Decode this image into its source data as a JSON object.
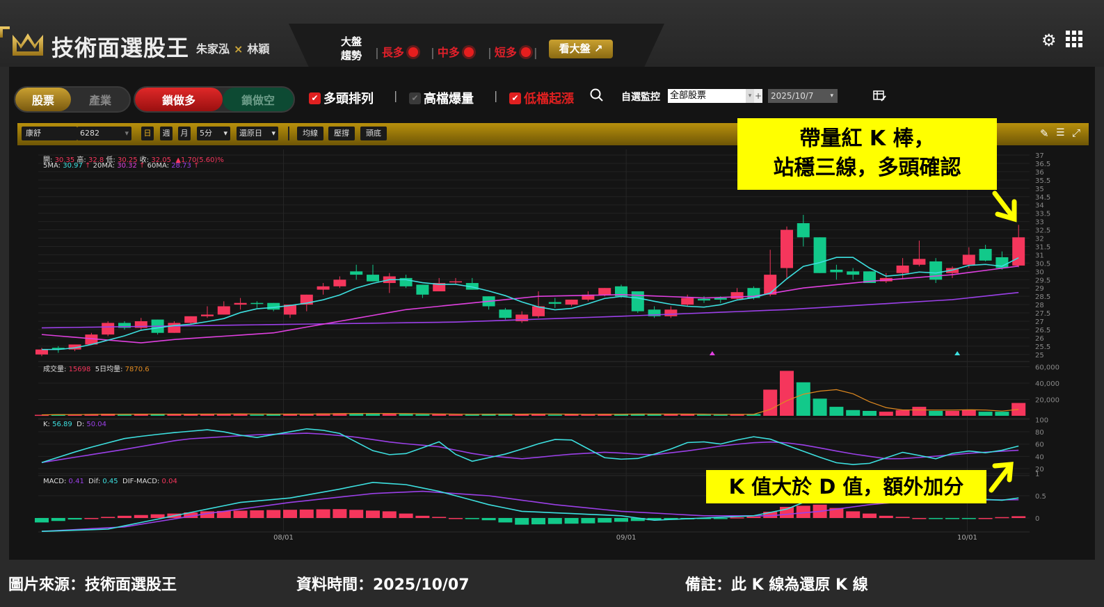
{
  "header": {
    "title": "技術面選股王",
    "author1": "朱家泓",
    "times": "×",
    "author2": "林穎",
    "trend_line1": "大盤",
    "trend_line2": "趨勢",
    "trends": [
      "長多",
      "中多",
      "短多"
    ],
    "view_market": "看大盤"
  },
  "filters": {
    "seg1": [
      "股票",
      "產業"
    ],
    "seg2": [
      "鎖做多",
      "鎖做空"
    ],
    "checks": [
      {
        "label": "多頭排列",
        "checked": true
      },
      {
        "label": "高檔爆量",
        "checked": false
      },
      {
        "label": "低檔起漲",
        "checked": true
      }
    ],
    "watch_label": "自選監控",
    "watch_value": "全部股票",
    "plus": "+",
    "date_value": "2025/10/7"
  },
  "chart_toolbar": {
    "stock_name": "康舒",
    "stock_code": "6282",
    "periods": [
      "日",
      "週",
      "月"
    ],
    "interval": "5分",
    "adjust": "還原日",
    "buttons": [
      "均線",
      "壓撐",
      "頭底"
    ]
  },
  "info": {
    "open_l": "開:",
    "open": "30.35",
    "high_l": "高:",
    "high": "32.8",
    "low_l": "低:",
    "low": "30.25",
    "close_l": "收:",
    "close": "32.05",
    "change": "▲1.70(5.60)%",
    "ma5_l": "5MA:",
    "ma5": "30.97",
    "ma20_l": "20MA:",
    "ma20": "30.32",
    "ma60_l": "60MA:",
    "ma60": "28.73",
    "arrow": "↑",
    "vol_l": "成交量:",
    "vol": "15698",
    "vol5_l": "5日均量:",
    "vol5": "7870.6",
    "k_l": "K:",
    "k": "56.89",
    "d_l": "D:",
    "d": "50.04",
    "macd_l": "MACD:",
    "macd": "0.41",
    "dif_l": "Dif:",
    "dif": "0.45",
    "osc_l": "DIF-MACD:",
    "osc": "0.04"
  },
  "annotations": {
    "box1_line1": "帶量紅 K 棒，",
    "box1_line2": "站穩三線，多頭確認",
    "box2": "K 值大於 D 值，額外加分"
  },
  "footer": {
    "source": "圖片來源：技術面選股王",
    "time": "資料時間：2025/10/07",
    "note": "備註：此 K 線為還原 K 線"
  },
  "colors": {
    "up": "#f5365c",
    "down": "#12c98a",
    "ma5": "#3de0e0",
    "ma20": "#e040e0",
    "ma60": "#9b40e8",
    "vol5": "#e08a20",
    "gold": "#c9a030"
  },
  "chart_data": {
    "type": "candlestick",
    "price_ticks": [
      "37",
      "36.5",
      "36",
      "35.5",
      "35",
      "34.5",
      "34",
      "33.5",
      "33",
      "32.5",
      "32",
      "31.5",
      "31",
      "30.5",
      "30",
      "29.5",
      "29",
      "28.5",
      "28",
      "27.5",
      "27",
      "26.5",
      "26",
      "25.5",
      "25"
    ],
    "volume_ticks": [
      "60,000",
      "40,000",
      "20,000"
    ],
    "kd_ticks": [
      "100",
      "80",
      "60",
      "40",
      "20"
    ],
    "macd_ticks": [
      "1",
      "0.5",
      "0"
    ],
    "date_ticks": [
      {
        "i": 14.6,
        "label": "08/01"
      },
      {
        "i": 35.3,
        "label": "09/01"
      },
      {
        "i": 55.9,
        "label": "10/01"
      }
    ],
    "ohlc": [
      [
        25.0,
        25.4,
        24.9,
        25.3
      ],
      [
        25.4,
        25.5,
        25.1,
        25.3
      ],
      [
        25.3,
        25.6,
        25.2,
        25.6
      ],
      [
        25.6,
        26.3,
        25.6,
        26.2
      ],
      [
        26.2,
        27.0,
        26.1,
        26.9
      ],
      [
        26.9,
        27.0,
        26.5,
        26.6
      ],
      [
        26.6,
        27.2,
        26.5,
        27.0
      ],
      [
        27.1,
        27.1,
        26.2,
        26.3
      ],
      [
        26.3,
        27.0,
        26.3,
        26.9
      ],
      [
        26.9,
        27.3,
        26.8,
        27.3
      ],
      [
        27.3,
        27.9,
        27.2,
        27.4
      ],
      [
        27.4,
        28.2,
        27.4,
        27.9
      ],
      [
        28.0,
        28.4,
        27.7,
        28.1
      ],
      [
        28.1,
        28.2,
        27.8,
        28.05
      ],
      [
        28.1,
        28.1,
        27.6,
        27.7
      ],
      [
        27.4,
        28.0,
        27.2,
        28.0
      ],
      [
        28.0,
        28.6,
        27.6,
        28.6
      ],
      [
        28.9,
        29.3,
        28.6,
        29.1
      ],
      [
        29.1,
        29.7,
        29.0,
        29.5
      ],
      [
        30.0,
        30.4,
        29.5,
        29.8
      ],
      [
        29.8,
        30.4,
        29.4,
        29.4
      ],
      [
        29.3,
        29.9,
        28.7,
        29.7
      ],
      [
        29.6,
        29.8,
        29.0,
        29.1
      ],
      [
        29.2,
        29.2,
        28.4,
        28.6
      ],
      [
        28.8,
        29.6,
        28.8,
        29.3
      ],
      [
        29.35,
        29.6,
        29.2,
        29.4
      ],
      [
        29.3,
        29.6,
        28.9,
        28.9
      ],
      [
        28.5,
        28.5,
        27.7,
        27.9
      ],
      [
        27.7,
        27.8,
        27.1,
        27.2
      ],
      [
        27.0,
        27.6,
        26.9,
        27.4
      ],
      [
        27.3,
        28.8,
        27.2,
        27.9
      ],
      [
        28.15,
        28.4,
        27.8,
        28.05
      ],
      [
        28.0,
        28.3,
        27.9,
        28.3
      ],
      [
        28.3,
        28.8,
        28.2,
        28.6
      ],
      [
        28.6,
        29.0,
        28.5,
        29.0
      ],
      [
        29.1,
        29.2,
        28.4,
        28.5
      ],
      [
        28.8,
        28.8,
        27.5,
        27.6
      ],
      [
        27.7,
        27.9,
        27.2,
        27.3
      ],
      [
        27.3,
        27.9,
        27.2,
        27.7
      ],
      [
        28.0,
        28.6,
        27.9,
        28.4
      ],
      [
        28.35,
        28.5,
        28.1,
        28.25
      ],
      [
        28.4,
        28.5,
        28.1,
        28.3
      ],
      [
        28.35,
        29.0,
        28.3,
        28.75
      ],
      [
        29.0,
        29.1,
        28.3,
        28.4
      ],
      [
        28.6,
        31.3,
        28.5,
        29.8
      ],
      [
        30.2,
        32.7,
        29.6,
        32.5
      ],
      [
        32.9,
        33.4,
        31.5,
        32.05
      ],
      [
        32.05,
        32.05,
        29.9,
        29.9
      ],
      [
        30.1,
        30.4,
        29.5,
        29.95
      ],
      [
        30.0,
        30.2,
        29.5,
        29.8
      ],
      [
        30.0,
        30.0,
        29.3,
        29.3
      ],
      [
        29.4,
        29.9,
        29.3,
        29.6
      ],
      [
        29.9,
        30.8,
        29.6,
        30.35
      ],
      [
        30.4,
        31.85,
        30.3,
        30.75
      ],
      [
        30.6,
        30.8,
        29.3,
        29.5
      ],
      [
        29.9,
        30.3,
        29.6,
        30.2
      ],
      [
        30.4,
        31.45,
        30.2,
        31.0
      ],
      [
        31.35,
        31.6,
        30.6,
        30.65
      ],
      [
        30.85,
        31.2,
        30.1,
        30.2
      ],
      [
        30.35,
        32.8,
        30.25,
        32.05
      ]
    ],
    "volume": [
      1200,
      1800,
      1500,
      2200,
      2500,
      1600,
      2300,
      1800,
      2100,
      2400,
      2000,
      2600,
      2500,
      1500,
      1800,
      2300,
      2600,
      3000,
      3200,
      2800,
      2500,
      2700,
      2200,
      1900,
      2100,
      1500,
      1700,
      2400,
      2600,
      2000,
      2200,
      1400,
      1800,
      1900,
      2300,
      2100,
      2600,
      1800,
      1900,
      2200,
      1500,
      1400,
      1900,
      2100,
      32000,
      55000,
      41000,
      21000,
      11000,
      7000,
      6000,
      5000,
      7000,
      11000,
      6000,
      6000,
      7000,
      5000,
      5000,
      15698
    ],
    "ma20_knots": [
      [
        0,
        26.2
      ],
      [
        6,
        25.7
      ],
      [
        8,
        25.9
      ],
      [
        14,
        26.3
      ],
      [
        18,
        27.0
      ],
      [
        22,
        27.7
      ],
      [
        26,
        28.1
      ],
      [
        30,
        28.5
      ],
      [
        35,
        28.6
      ],
      [
        40,
        28.4
      ],
      [
        43,
        28.5
      ],
      [
        46,
        29.0
      ],
      [
        50,
        29.4
      ],
      [
        55,
        29.8
      ],
      [
        59,
        30.32
      ]
    ],
    "ma60_knots": [
      [
        0,
        26.6
      ],
      [
        14,
        26.8
      ],
      [
        25,
        26.95
      ],
      [
        35,
        27.3
      ],
      [
        45,
        27.7
      ],
      [
        55,
        28.3
      ],
      [
        59,
        28.73
      ]
    ],
    "k_knots": [
      [
        0,
        30
      ],
      [
        3,
        52
      ],
      [
        6,
        70
      ],
      [
        9,
        78
      ],
      [
        12,
        84
      ],
      [
        15,
        70
      ],
      [
        19,
        86
      ],
      [
        21,
        78
      ],
      [
        24,
        42
      ],
      [
        26,
        45
      ],
      [
        28,
        65
      ],
      [
        30,
        30
      ],
      [
        33,
        45
      ],
      [
        35,
        60
      ],
      [
        37,
        72
      ],
      [
        40,
        35
      ],
      [
        42,
        36
      ],
      [
        44,
        48
      ],
      [
        46,
        66
      ],
      [
        48,
        60
      ],
      [
        50,
        72
      ],
      [
        51,
        72
      ],
      [
        53,
        55
      ],
      [
        56,
        30
      ],
      [
        58,
        25
      ],
      [
        61,
        48
      ],
      [
        63,
        35
      ],
      [
        65,
        50
      ],
      [
        67,
        45
      ],
      [
        69,
        56.89
      ]
    ],
    "d_knots": [
      [
        0,
        30
      ],
      [
        6,
        52
      ],
      [
        10,
        68
      ],
      [
        15,
        75
      ],
      [
        19,
        78
      ],
      [
        22,
        72
      ],
      [
        25,
        62
      ],
      [
        28,
        56
      ],
      [
        31,
        42
      ],
      [
        34,
        36
      ],
      [
        37,
        43
      ],
      [
        40,
        47
      ],
      [
        43,
        42
      ],
      [
        46,
        50
      ],
      [
        48,
        57
      ],
      [
        50,
        62
      ],
      [
        52,
        64
      ],
      [
        54,
        58
      ],
      [
        57,
        45
      ],
      [
        60,
        35
      ],
      [
        63,
        40
      ],
      [
        66,
        46
      ],
      [
        69,
        50.04
      ]
    ],
    "kd_index_scale": 0.855,
    "dif_knots": [
      [
        0,
        -0.3
      ],
      [
        4,
        -0.25
      ],
      [
        8,
        0.05
      ],
      [
        12,
        0.35
      ],
      [
        15,
        0.45
      ],
      [
        18,
        0.65
      ],
      [
        20,
        0.8
      ],
      [
        22,
        0.75
      ],
      [
        24,
        0.6
      ],
      [
        27,
        0.3
      ],
      [
        29,
        0.15
      ],
      [
        32,
        0.1
      ],
      [
        35,
        0.05
      ],
      [
        37,
        -0.05
      ],
      [
        40,
        0.0
      ],
      [
        43,
        0.05
      ],
      [
        45,
        0.2
      ],
      [
        47,
        0.5
      ],
      [
        49,
        0.65
      ],
      [
        52,
        0.5
      ],
      [
        55,
        0.45
      ],
      [
        58,
        0.4
      ],
      [
        59,
        0.45
      ]
    ],
    "macd_knots": [
      [
        0,
        -0.3
      ],
      [
        5,
        -0.2
      ],
      [
        10,
        0.1
      ],
      [
        15,
        0.35
      ],
      [
        20,
        0.55
      ],
      [
        23,
        0.6
      ],
      [
        27,
        0.5
      ],
      [
        31,
        0.3
      ],
      [
        35,
        0.15
      ],
      [
        40,
        0.05
      ],
      [
        44,
        0.05
      ],
      [
        47,
        0.15
      ],
      [
        50,
        0.3
      ],
      [
        53,
        0.4
      ],
      [
        59,
        0.41
      ]
    ],
    "osc_knots": [
      [
        0,
        -0.1
      ],
      [
        3,
        0.0
      ],
      [
        5,
        0.05
      ],
      [
        8,
        0.1
      ],
      [
        10,
        0.15
      ],
      [
        14,
        0.18
      ],
      [
        18,
        0.2
      ],
      [
        21,
        0.15
      ],
      [
        23,
        0.05
      ],
      [
        27,
        -0.05
      ],
      [
        29,
        -0.15
      ],
      [
        33,
        -0.12
      ],
      [
        37,
        -0.05
      ],
      [
        40,
        -0.02
      ],
      [
        43,
        0.03
      ],
      [
        45,
        0.25
      ],
      [
        47,
        0.3
      ],
      [
        49,
        0.15
      ],
      [
        51,
        0.05
      ],
      [
        53,
        0.0
      ],
      [
        55,
        -0.02
      ],
      [
        57,
        0.0
      ],
      [
        59,
        0.04
      ]
    ]
  }
}
